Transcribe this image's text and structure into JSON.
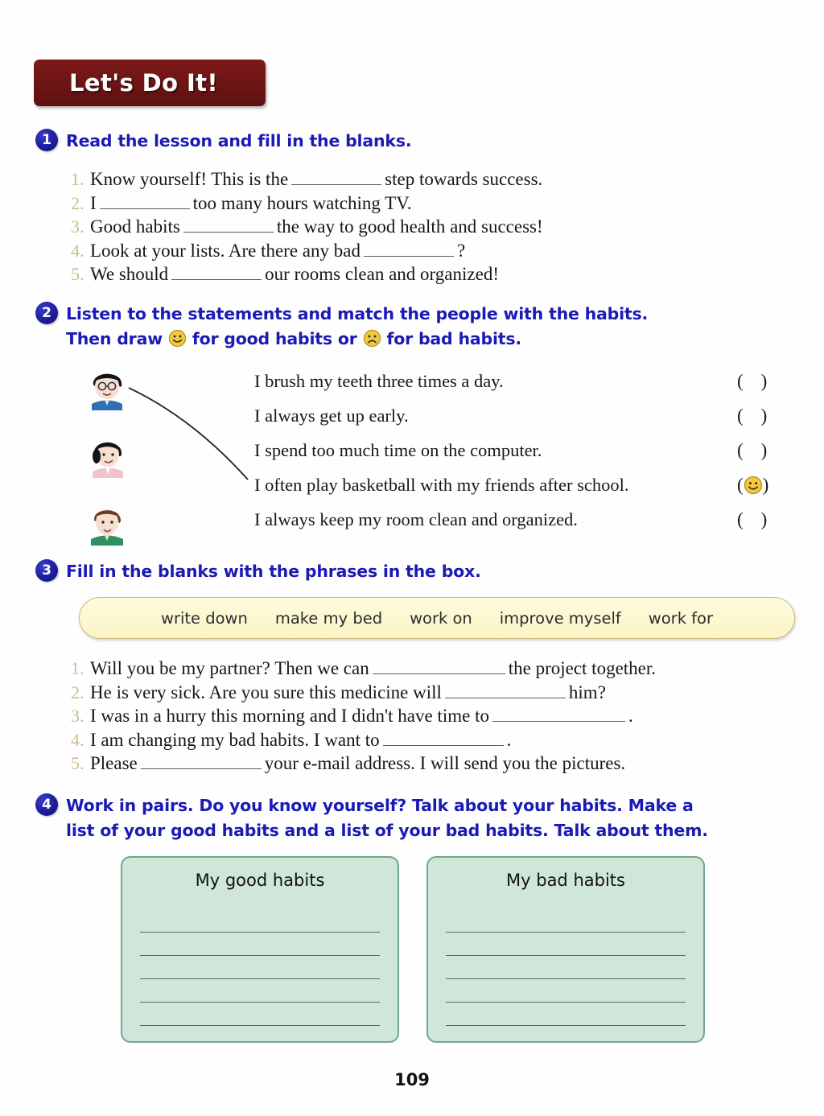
{
  "banner": {
    "label": "Let's Do It!"
  },
  "page_number": "109",
  "colors": {
    "banner_bg": "#6d1414",
    "badge_blue": "#1d1d9c",
    "heading_blue": "#1b1bb4",
    "item_number_tan": "#cbbb8f",
    "phrase_box_fill": "#faf5c6",
    "phrase_box_border": "#cdb87d",
    "habit_box_fill": "#cfe6d9",
    "habit_box_border": "#74a68d",
    "smiley_yellow": "#f2c83c"
  },
  "exercise1": {
    "number": "1",
    "title": "Read the lesson and fill in the blanks.",
    "items": [
      {
        "num": "1.",
        "before": "Know yourself! This is the",
        "after": "step towards success."
      },
      {
        "num": "2.",
        "before": "I",
        "after": "too many hours watching TV."
      },
      {
        "num": "3.",
        "before": "Good habits",
        "after": "the way to good health and success!"
      },
      {
        "num": "4.",
        "before": "Look at your lists. Are there any bad",
        "after": "?"
      },
      {
        "num": "5.",
        "before": "We should",
        "after": "our rooms clean and organized!"
      }
    ]
  },
  "exercise2": {
    "number": "2",
    "title_line1": "Listen to the statements and match the people with the habits.",
    "title_line2_a": "Then draw",
    "title_line2_b": "for good habits or",
    "title_line2_c": "for bad habits.",
    "avatars": [
      {
        "name": "boy-with-glasses-blue-shirt"
      },
      {
        "name": "girl-with-ponytail-pink-shirt"
      },
      {
        "name": "boy-green-shirt"
      }
    ],
    "statements": [
      {
        "text": "I brush my teeth three times a day.",
        "answer": ""
      },
      {
        "text": "I always get up early.",
        "answer": ""
      },
      {
        "text": "I spend too much time on the computer.",
        "answer": ""
      },
      {
        "text": "I often play basketball with my friends after school.",
        "answer": "smiley"
      },
      {
        "text": "I always keep my room clean and organized.",
        "answer": ""
      }
    ]
  },
  "exercise3": {
    "number": "3",
    "title": "Fill in the blanks with the phrases in the box.",
    "phrases": [
      "write down",
      "make my bed",
      "work on",
      "improve myself",
      "work for"
    ],
    "items": [
      {
        "num": "1.",
        "before": "Will you be my partner? Then we can",
        "after": "the project together."
      },
      {
        "num": "2.",
        "before": "He is very sick. Are you sure this medicine will",
        "after": "him?"
      },
      {
        "num": "3.",
        "before": "I was in a hurry this morning and I didn't have time to",
        "after": "."
      },
      {
        "num": "4.",
        "before": "I am changing my bad habits. I want to",
        "after": "."
      },
      {
        "num": "5.",
        "before": "Please",
        "after": "your e-mail address. I will send you the pictures."
      }
    ]
  },
  "exercise4": {
    "number": "4",
    "title_line1": "Work in pairs. Do you know yourself? Talk about your habits. Make a",
    "title_line2": "list of your good habits and a list of your bad habits. Talk about them.",
    "boxes": [
      {
        "title": "My good habits",
        "lines": 5
      },
      {
        "title": "My bad habits",
        "lines": 5
      }
    ]
  }
}
